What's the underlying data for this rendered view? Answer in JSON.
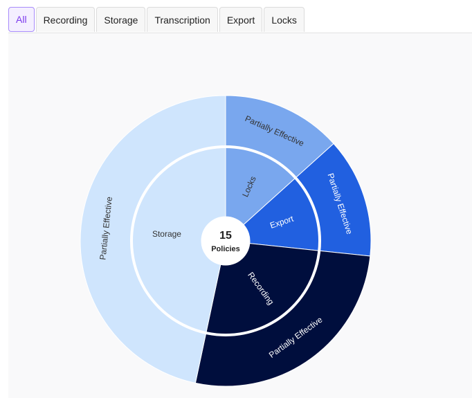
{
  "tabs": [
    {
      "label": "All",
      "active": true
    },
    {
      "label": "Recording",
      "active": false
    },
    {
      "label": "Storage",
      "active": false
    },
    {
      "label": "Transcription",
      "active": false
    },
    {
      "label": "Export",
      "active": false
    },
    {
      "label": "Locks",
      "active": false
    }
  ],
  "center": {
    "count": "15",
    "label": "Policies"
  },
  "chart_data": {
    "type": "sunburst",
    "total": 15,
    "inner": [
      {
        "name": "Locks",
        "value": 2,
        "color": "#79a7ee",
        "text_color": "#333333"
      },
      {
        "name": "Export",
        "value": 2,
        "color": "#2160e0",
        "text_color": "#ffffff"
      },
      {
        "name": "Recording",
        "value": 4,
        "color": "#000e3d",
        "text_color": "#ffffff"
      },
      {
        "name": "Storage",
        "value": 7,
        "color": "#cfe5fd",
        "text_color": "#333333"
      }
    ],
    "outer": [
      {
        "name": "Partially Effective",
        "parent": "Locks",
        "value": 2,
        "color": "#79a7ee",
        "text_color": "#333333"
      },
      {
        "name": "Partially Effective",
        "parent": "Export",
        "value": 2,
        "color": "#2160e0",
        "text_color": "#ffffff"
      },
      {
        "name": "Partially Effective",
        "parent": "Recording",
        "value": 4,
        "color": "#000e3d",
        "text_color": "#ffffff"
      },
      {
        "name": "Partially Effective",
        "parent": "Storage",
        "value": 7,
        "color": "#cfe5fd",
        "text_color": "#333333"
      }
    ]
  }
}
